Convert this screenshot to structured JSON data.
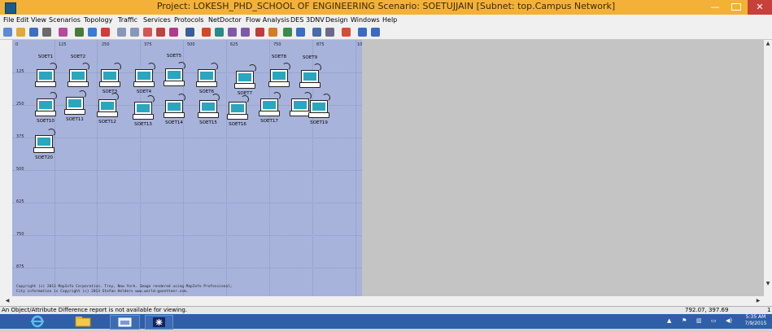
{
  "window": {
    "title": "Project: LOKESH_PHD_SCHOOL OF ENGINEERING Scenario: SOETUJJAIN  [Subnet: top.Campus Network]",
    "minimize": "—",
    "close": "✕"
  },
  "menu": [
    "File",
    "Edit",
    "View",
    "Scenarios",
    "Topology",
    "Traffic",
    "Services",
    "Protocols",
    "NetDoctor",
    "Flow Analysis",
    "DES",
    "3DNV",
    "Design",
    "Windows",
    "Help"
  ],
  "canvas": {
    "x_ticks": [
      "0",
      "125",
      "250",
      "375",
      "500",
      "625",
      "750",
      "875",
      "10"
    ],
    "y_ticks": [
      "125",
      "250",
      "375",
      "500",
      "625",
      "750",
      "875"
    ],
    "copyright_line1": "Copyright (c) 2013 MapInfo Corporation. Troy, New York. Image rendered using MapInfo Professional;",
    "copyright_line2": "City information is Copyright (c) 2013 Stefan Helders www.world-gazetteer.com."
  },
  "nodes": [
    {
      "label": "SOET1"
    },
    {
      "label": "SOET2"
    },
    {
      "label": "SOET3"
    },
    {
      "label": "SOET4"
    },
    {
      "label": "SOET5"
    },
    {
      "label": "SOET6"
    },
    {
      "label": "SOET7"
    },
    {
      "label": "SOET8"
    },
    {
      "label": "SOET9"
    },
    {
      "label": "SOET10"
    },
    {
      "label": "SOET11"
    },
    {
      "label": "SOET12"
    },
    {
      "label": "SOET13"
    },
    {
      "label": "SOET14"
    },
    {
      "label": "SOET15"
    },
    {
      "label": "SOET16"
    },
    {
      "label": "SOET17"
    },
    {
      "label": "SOET19"
    },
    {
      "label": "SOET20"
    }
  ],
  "status": {
    "message": "An Object/Attribute Difference report is not available for viewing.",
    "coords": "792.07, 397.69",
    "page": "1"
  },
  "taskbar": {
    "time": "5:35 AM",
    "date": "7/9/2015"
  }
}
